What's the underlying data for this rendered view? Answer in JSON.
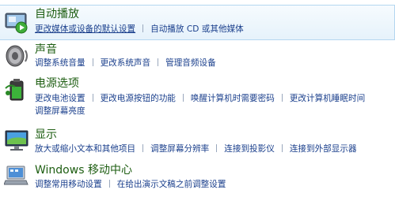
{
  "colors": {
    "title": "#1e5e12",
    "link": "#1a3f8c",
    "highlight_bg": "#e6f2fb",
    "highlight_border": "#b4d6f0"
  },
  "sections": [
    {
      "icon": "autoplay-icon",
      "title": "自动播放",
      "links": [
        "更改媒体或设备的默认设置",
        "自动播放 CD 或其他媒体"
      ]
    },
    {
      "icon": "speaker-icon",
      "title": "声音",
      "links": [
        "调整系统音量",
        "更改系统声音",
        "管理音频设备"
      ]
    },
    {
      "icon": "battery-icon",
      "title": "电源选项",
      "links": [
        "更改电池设置",
        "更改电源按钮的功能",
        "唤醒计算机时需要密码",
        "更改计算机睡眠时间"
      ],
      "links2": [
        "调整屏幕亮度"
      ]
    },
    {
      "icon": "monitor-icon",
      "title": "显示",
      "links": [
        "放大或缩小文本和其他项目",
        "调整屏幕分辨率",
        "连接到投影仪",
        "连接到外部显示器"
      ]
    },
    {
      "icon": "mobility-center-icon",
      "title": "Windows 移动中心",
      "links": [
        "调整常用移动设置",
        "在给出演示文稿之前调整设置"
      ]
    }
  ]
}
